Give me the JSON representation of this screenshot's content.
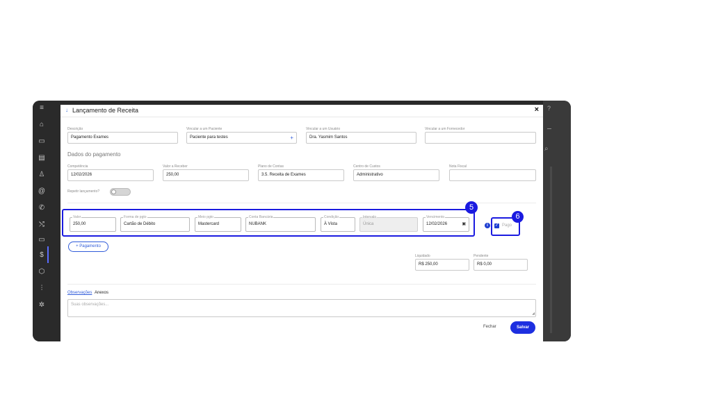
{
  "modal": {
    "title": "Lançamento de Receita",
    "close": "×"
  },
  "row1": {
    "descricao_label": "Descrição",
    "descricao_value": "Pagamento Exames",
    "paciente_label": "Vincular a um Paciente",
    "paciente_value": "Paciente para testes",
    "paciente_add": "+",
    "usuario_label": "Vincular a um Usuário",
    "usuario_value": "Dra. Yasmim Santos",
    "fornecedor_label": "Vincular a um Fornecedor",
    "fornecedor_value": ""
  },
  "section_title": "Dados do pagamento",
  "row2": {
    "competencia_label": "Competência",
    "competencia_value": "12/02/2026",
    "valor_label": "Valor a Receber",
    "valor_value": "250,00",
    "plano_label": "Plano de Contas",
    "plano_value": "3.5. Receita de Exames",
    "centro_label": "Centro de Custos",
    "centro_value": "Administrativo",
    "nota_label": "Nota Fiscal",
    "nota_value": ""
  },
  "repetir_label": "Repetir lançamento?",
  "payment": {
    "valor_label": "Valor",
    "valor_value": "250,00",
    "forma_label": "Forma de pgto",
    "forma_value": "Cartão de Débito",
    "meio_label": "Meio pgto",
    "meio_value": "Mastercard",
    "conta_label": "Conta Bancária",
    "conta_value": "NUBANK",
    "condicao_label": "Condição",
    "condicao_value": "À Vista",
    "intervalo_label": "Intervalo",
    "intervalo_value": "Única",
    "vencimento_label": "Vencimento",
    "vencimento_value": "12/02/2026",
    "pago_label": "Pago"
  },
  "badges": {
    "five": "5",
    "six": "6"
  },
  "add_payment": "+ Pagamento",
  "totals": {
    "liquidado_label": "Liquidado",
    "liquidado_value": "R$ 250,00",
    "pendente_label": "Pendente",
    "pendente_value": "R$ 0,00"
  },
  "tabs": {
    "observacoes": "Observações",
    "anexos": "Anexos"
  },
  "observacoes_placeholder": "Suas observações...",
  "actions": {
    "fechar": "Fechar",
    "salvar": "Salvar"
  },
  "colors": {
    "accent": "#1d2fe0",
    "highlight": "#1a1ae0",
    "frame": "#2a2a2a"
  }
}
